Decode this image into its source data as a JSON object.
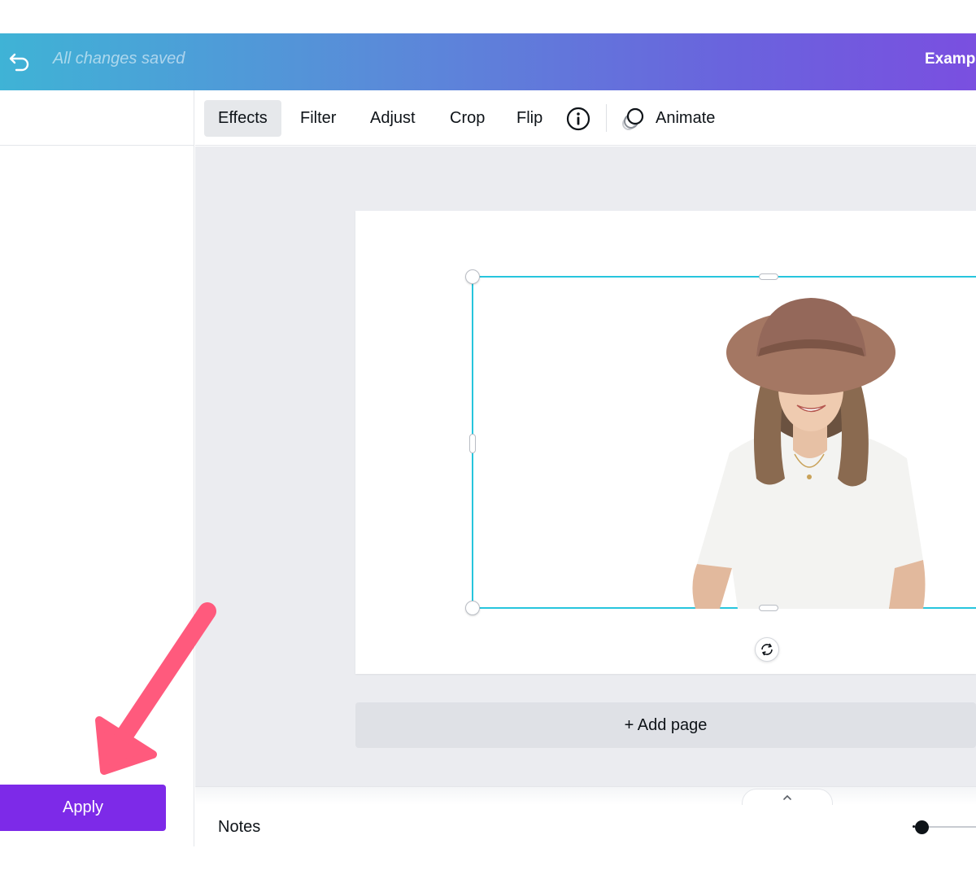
{
  "header": {
    "status_text": "All changes saved",
    "design_title": "Example",
    "undo_icon": "undo-arrow-icon",
    "gradient_start": "#3fb3d6",
    "gradient_end": "#7a4fe0"
  },
  "toolbar": {
    "tools": [
      {
        "label": "Effects",
        "active": true
      },
      {
        "label": "Filter",
        "active": false
      },
      {
        "label": "Adjust",
        "active": false
      },
      {
        "label": "Crop",
        "active": false
      },
      {
        "label": "Flip",
        "active": false
      }
    ],
    "info_icon": "info-icon",
    "animate_label": "Animate",
    "animate_icon": "animate-circles-icon"
  },
  "left_panel": {
    "apply_label": "Apply",
    "apply_color": "#7d2ae8"
  },
  "canvas": {
    "selection_color": "#27c5dd",
    "image_description_icon": "photo-woman-in-hat",
    "rotate_icon": "rotate-icon",
    "add_page_label": "+ Add page"
  },
  "footer": {
    "notes_label": "Notes",
    "collapse_icon": "chevron-up-icon"
  },
  "annotation": {
    "arrow_color": "#ff5a7d",
    "arrow_icon": "pink-arrow-pointer"
  }
}
